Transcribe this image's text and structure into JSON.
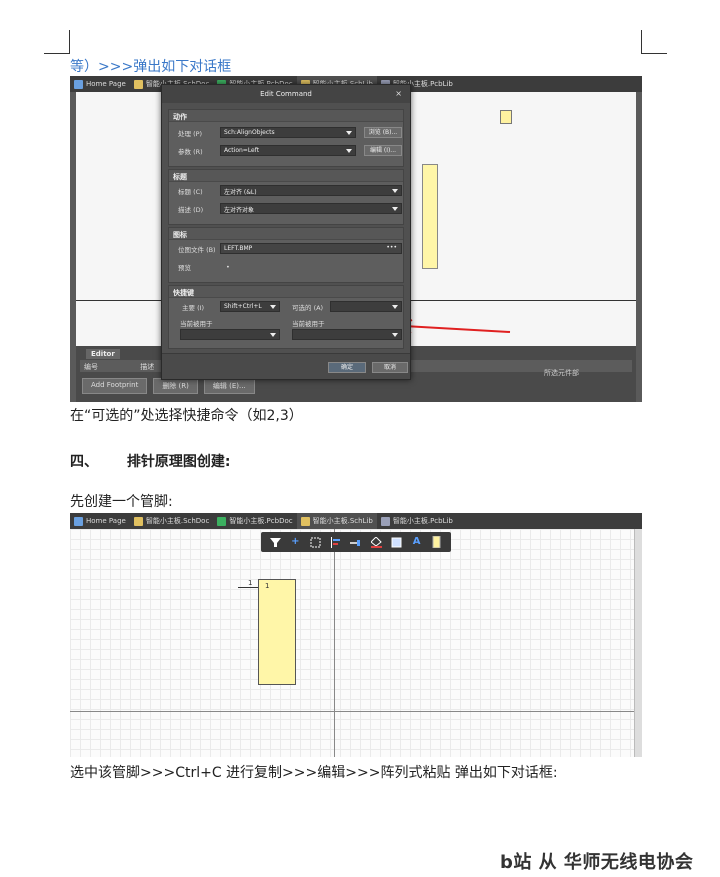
{
  "heading_line": "等）>>>弹出如下对话框",
  "screenshot1": {
    "tabs": [
      {
        "label": "Home Page",
        "icon": "home-icon"
      },
      {
        "label": "智能小主板.SchDoc",
        "icon": "sch-icon"
      },
      {
        "label": "智能小主板.PcbDoc",
        "icon": "pcb-icon"
      },
      {
        "label": "智能小主板.SchLib",
        "icon": "schlib-icon"
      },
      {
        "label": "智能小主板.PcbLib",
        "icon": "pcblib-icon"
      }
    ],
    "dialog": {
      "title": "Edit Command",
      "close": "×",
      "sections": {
        "action": {
          "title": "动作",
          "process_label": "处理 (P)",
          "process_value": "Sch:AlignObjects",
          "browse_button": "浏览 (B)...",
          "params_label": "参数 (R)",
          "params_value": "Action=Left",
          "edit_button": "编辑 (I)..."
        },
        "caption": {
          "title": "标题",
          "caption_label": "标题 (C)",
          "caption_value": "左对齐 (&L)",
          "desc_label": "描述 (D)",
          "desc_value": "左对齐对象"
        },
        "icon": {
          "title": "图标",
          "file_label": "位图文件 (B)",
          "file_value": "LEFT.BMP",
          "more": "•••",
          "preview_label": "预览",
          "preview_value": "•"
        },
        "shortcut": {
          "title": "快捷键",
          "primary_label": "主要 (I)",
          "primary_value": "Shift+Ctrl+L",
          "optional_label": "可选的 (A)",
          "optional_value": "",
          "cur_used1": "当前被用于",
          "cur_used2": "当前被用于"
        }
      },
      "ok_button": "确定",
      "cancel_button": "取消"
    },
    "editor": {
      "tab_label": "Editor",
      "row_label": "编号",
      "row_label2": "描述",
      "buttons": [
        "Add Footprint",
        "删除 (R)",
        "编辑 (E)..."
      ],
      "right_label": "所选元件部"
    }
  },
  "para1": "在“可选的”处选择快捷命令（如2,3）",
  "section_heading_num": "四、",
  "section_heading_text": "排针原理图创建:",
  "para2": "先创建一个管脚:",
  "screenshot2": {
    "tabs": [
      {
        "label": "Home Page",
        "icon": "home-icon"
      },
      {
        "label": "智能小主板.SchDoc",
        "icon": "sch-icon"
      },
      {
        "label": "智能小主板.PcbDoc",
        "icon": "pcb-icon"
      },
      {
        "label": "智能小主板.SchLib",
        "icon": "schlib-icon"
      },
      {
        "label": "智能小主板.PcbLib",
        "icon": "pcblib-icon"
      }
    ],
    "toolbar_tools": [
      "filter-icon",
      "plus-icon",
      "rect-select-icon",
      "align-icon",
      "pin-icon",
      "color-icon",
      "fill-icon",
      "text-icon",
      "part-icon"
    ],
    "pin_mark": "1",
    "pin_number": "1"
  },
  "para3": "选中该管脚>>>Ctrl+C  进行复制>>>编辑>>>阵列式粘贴   弹出如下对话框:",
  "watermark": "b站 从 华师无线电协会"
}
